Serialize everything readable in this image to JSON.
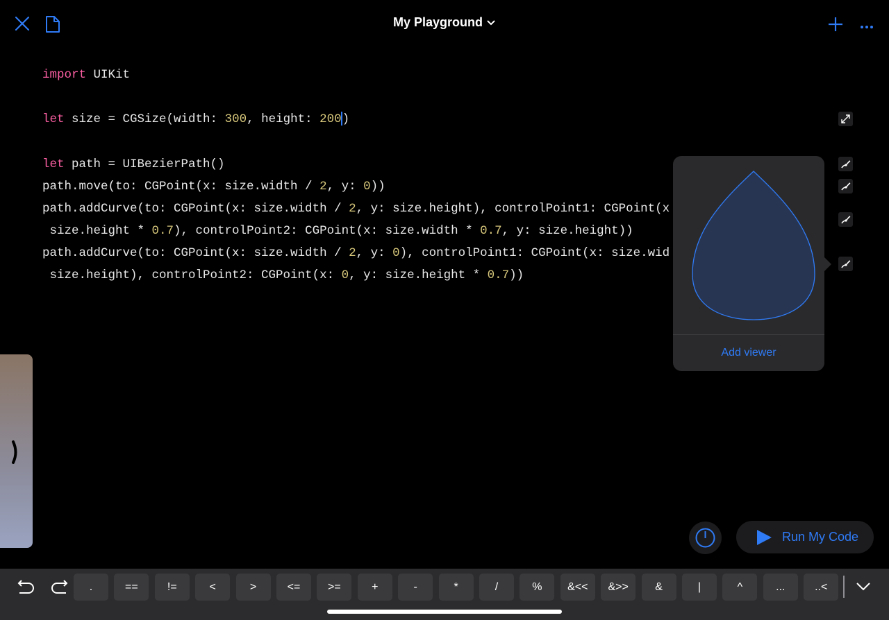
{
  "header": {
    "title": "My Playground"
  },
  "code": [
    [
      [
        "kw",
        "import"
      ],
      [
        "t",
        " UIKit"
      ]
    ],
    [],
    [
      [
        "kw",
        "let"
      ],
      [
        "t",
        " size = CGSize(width: "
      ],
      [
        "num",
        "300"
      ],
      [
        "t",
        ", height: "
      ],
      [
        "num",
        "200"
      ],
      [
        "cursor",
        ""
      ],
      [
        "t",
        ")"
      ]
    ],
    [],
    [
      [
        "kw",
        "let"
      ],
      [
        "t",
        " path = UIBezierPath()"
      ]
    ],
    [
      [
        "t",
        "path.move(to: CGPoint(x: size.width / "
      ],
      [
        "num",
        "2"
      ],
      [
        "t",
        ", y: "
      ],
      [
        "num",
        "0"
      ],
      [
        "t",
        "))"
      ]
    ],
    [
      [
        "t",
        "path.addCurve(to: CGPoint(x: size.width / "
      ],
      [
        "num",
        "2"
      ],
      [
        "t",
        ", y: size.height), controlPoint1: CGPoint(x"
      ]
    ],
    [
      [
        "t",
        " size.height * "
      ],
      [
        "num",
        "0.7"
      ],
      [
        "t",
        "), controlPoint2: CGPoint(x: size.width * "
      ],
      [
        "num",
        "0.7"
      ],
      [
        "t",
        ", y: size.height))"
      ]
    ],
    [
      [
        "t",
        "path.addCurve(to: CGPoint(x: size.width / "
      ],
      [
        "num",
        "2"
      ],
      [
        "t",
        ", y: "
      ],
      [
        "num",
        "0"
      ],
      [
        "t",
        "), controlPoint1: CGPoint(x: size.wid"
      ]
    ],
    [
      [
        "t",
        " size.height), controlPoint2: CGPoint(x: "
      ],
      [
        "num",
        "0"
      ],
      [
        "t",
        ", y: size.height * "
      ],
      [
        "num",
        "0.7"
      ],
      [
        "t",
        "))"
      ]
    ]
  ],
  "viewer": {
    "add_label": "Add viewer"
  },
  "run": {
    "label": "Run My Code"
  },
  "keys": [
    ".",
    "==",
    "!=",
    "<",
    ">",
    "<=",
    ">=",
    "+",
    "-",
    "*",
    "/",
    "%",
    "&<<",
    "&>>",
    "&",
    "|",
    "^",
    "...",
    "..<"
  ],
  "colors": {
    "accent": "#2f7bf6",
    "keyword": "#fc5fa3",
    "number": "#d9c97c"
  }
}
